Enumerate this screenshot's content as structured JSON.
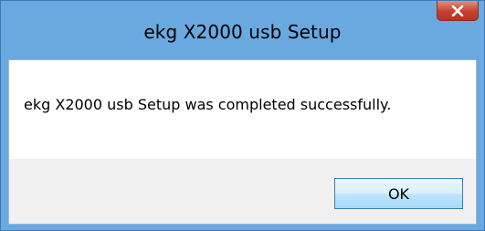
{
  "window": {
    "title": "ekg X2000 usb Setup",
    "close_icon": "close-icon",
    "colors": {
      "frame": "#6aa9e0",
      "close_button": "#c7402f",
      "footer": "#f0f0f0"
    }
  },
  "dialog": {
    "message": "ekg X2000 usb Setup was completed successfully.",
    "ok_label": "OK"
  }
}
